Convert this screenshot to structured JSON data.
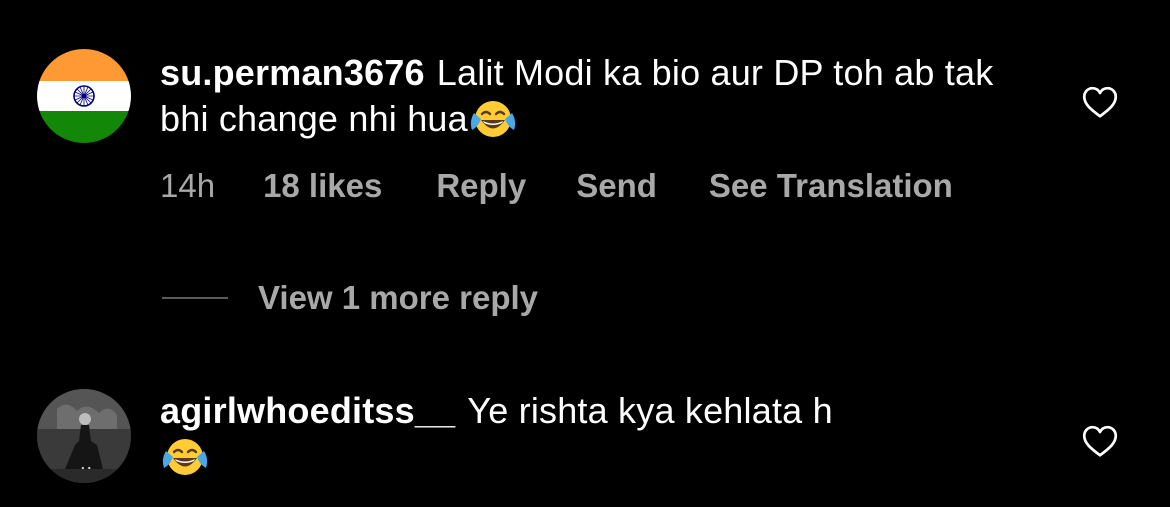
{
  "comments": [
    {
      "username": "su.perman3676",
      "text": "Lalit Modi ka bio aur DP toh ab tak bhi change nhi hua",
      "emoji": "face-with-tears-of-joy",
      "avatar": "indian-flag",
      "time": "14h",
      "likes": "18 likes",
      "actions": {
        "reply": "Reply",
        "send": "Send",
        "translate": "See Translation"
      },
      "view_more": "View 1 more reply"
    },
    {
      "username": "agirlwhoeditss__",
      "text": "Ye rishta kya kehlata h",
      "emoji": "face-with-tears-of-joy",
      "avatar": "profile-photo"
    }
  ],
  "colors": {
    "background": "#000000",
    "primary_text": "#ffffff",
    "secondary_text": "#a8a8a8",
    "flag_saffron": "#FF9933",
    "flag_green": "#138808",
    "chakra_blue": "#000080"
  },
  "icons": {
    "like": "heart-outline-icon"
  }
}
